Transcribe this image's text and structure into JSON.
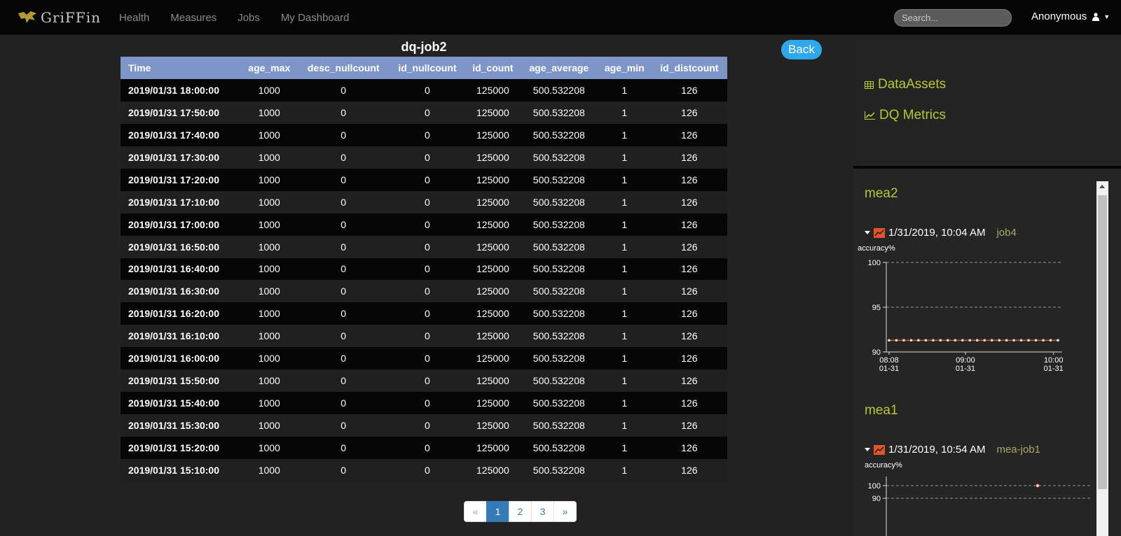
{
  "navbar": {
    "brand": "GriFFin",
    "links": [
      "Health",
      "Measures",
      "Jobs",
      "My Dashboard"
    ],
    "search_placeholder": "Search...",
    "user": "Anonymous"
  },
  "main": {
    "title": "dq-job2",
    "back_label": "Back",
    "table": {
      "headers": [
        "Time",
        "age_max",
        "desc_nullcount",
        "id_nullcount",
        "id_count",
        "age_average",
        "age_min",
        "id_distcount"
      ],
      "rows": [
        [
          "2019/01/31 18:00:00",
          "1000",
          "0",
          "0",
          "125000",
          "500.532208",
          "1",
          "126"
        ],
        [
          "2019/01/31 17:50:00",
          "1000",
          "0",
          "0",
          "125000",
          "500.532208",
          "1",
          "126"
        ],
        [
          "2019/01/31 17:40:00",
          "1000",
          "0",
          "0",
          "125000",
          "500.532208",
          "1",
          "126"
        ],
        [
          "2019/01/31 17:30:00",
          "1000",
          "0",
          "0",
          "125000",
          "500.532208",
          "1",
          "126"
        ],
        [
          "2019/01/31 17:20:00",
          "1000",
          "0",
          "0",
          "125000",
          "500.532208",
          "1",
          "126"
        ],
        [
          "2019/01/31 17:10:00",
          "1000",
          "0",
          "0",
          "125000",
          "500.532208",
          "1",
          "126"
        ],
        [
          "2019/01/31 17:00:00",
          "1000",
          "0",
          "0",
          "125000",
          "500.532208",
          "1",
          "126"
        ],
        [
          "2019/01/31 16:50:00",
          "1000",
          "0",
          "0",
          "125000",
          "500.532208",
          "1",
          "126"
        ],
        [
          "2019/01/31 16:40:00",
          "1000",
          "0",
          "0",
          "125000",
          "500.532208",
          "1",
          "126"
        ],
        [
          "2019/01/31 16:30:00",
          "1000",
          "0",
          "0",
          "125000",
          "500.532208",
          "1",
          "126"
        ],
        [
          "2019/01/31 16:20:00",
          "1000",
          "0",
          "0",
          "125000",
          "500.532208",
          "1",
          "126"
        ],
        [
          "2019/01/31 16:10:00",
          "1000",
          "0",
          "0",
          "125000",
          "500.532208",
          "1",
          "126"
        ],
        [
          "2019/01/31 16:00:00",
          "1000",
          "0",
          "0",
          "125000",
          "500.532208",
          "1",
          "126"
        ],
        [
          "2019/01/31 15:50:00",
          "1000",
          "0",
          "0",
          "125000",
          "500.532208",
          "1",
          "126"
        ],
        [
          "2019/01/31 15:40:00",
          "1000",
          "0",
          "0",
          "125000",
          "500.532208",
          "1",
          "126"
        ],
        [
          "2019/01/31 15:30:00",
          "1000",
          "0",
          "0",
          "125000",
          "500.532208",
          "1",
          "126"
        ],
        [
          "2019/01/31 15:20:00",
          "1000",
          "0",
          "0",
          "125000",
          "500.532208",
          "1",
          "126"
        ],
        [
          "2019/01/31 15:10:00",
          "1000",
          "0",
          "0",
          "125000",
          "500.532208",
          "1",
          "126"
        ]
      ]
    },
    "pagination": {
      "prev": "«",
      "pages": [
        "1",
        "2",
        "3"
      ],
      "active_page": "1",
      "next": "»"
    }
  },
  "sidebar": {
    "links": [
      {
        "label": "DataAssets",
        "icon": "table-icon"
      },
      {
        "label": "DQ Metrics",
        "icon": "line-chart-icon"
      }
    ],
    "measures": [
      {
        "name": "mea2",
        "timestamp": "1/31/2019, 10:04 AM",
        "job": "job4",
        "y_label": "accuracy%",
        "y_ticks": [
          "100",
          "95",
          "90"
        ],
        "x_ticks": [
          {
            "time": "08:08",
            "date": "01-31"
          },
          {
            "time": "09:00",
            "date": "01-31"
          },
          {
            "time": "10:00",
            "date": "01-31"
          }
        ]
      },
      {
        "name": "mea1",
        "timestamp": "1/31/2019, 10:54 AM",
        "job": "mea-job1",
        "y_label": "accuracy%",
        "y_ticks": [
          "100",
          "90"
        ]
      }
    ]
  },
  "colors": {
    "accent": "#b8c832",
    "table_header": "#7d95c7",
    "back_button": "#2ea8e8",
    "pager_active": "#337ab7",
    "chart_line": "#e0552b"
  },
  "chart_data": [
    {
      "type": "line",
      "series": [
        {
          "x": [
            "08:08",
            "08:13",
            "08:18",
            "08:23",
            "08:28",
            "08:33",
            "08:38",
            "08:43",
            "08:48",
            "08:53",
            "08:58",
            "09:03",
            "09:08",
            "09:13",
            "09:18",
            "09:23",
            "09:28",
            "09:33",
            "09:38",
            "09:43",
            "09:48",
            "09:53",
            "09:58",
            "10:03"
          ],
          "values": [
            91.3,
            91.3,
            91.3,
            91.3,
            91.3,
            91.3,
            91.3,
            91.3,
            91.3,
            91.3,
            91.3,
            91.3,
            91.3,
            91.3,
            91.3,
            91.3,
            91.3,
            91.3,
            91.3,
            91.3,
            91.3,
            91.3,
            91.3,
            91.3
          ]
        }
      ],
      "ylabel": "accuracy%",
      "ylim": [
        90,
        100
      ],
      "xlim": [
        "08:08",
        "10:03"
      ],
      "grid": true
    },
    {
      "type": "scatter",
      "series": [
        {
          "x": [
            "10:54"
          ],
          "values": [
            100
          ]
        }
      ],
      "ylabel": "accuracy%",
      "grid": true
    }
  ]
}
